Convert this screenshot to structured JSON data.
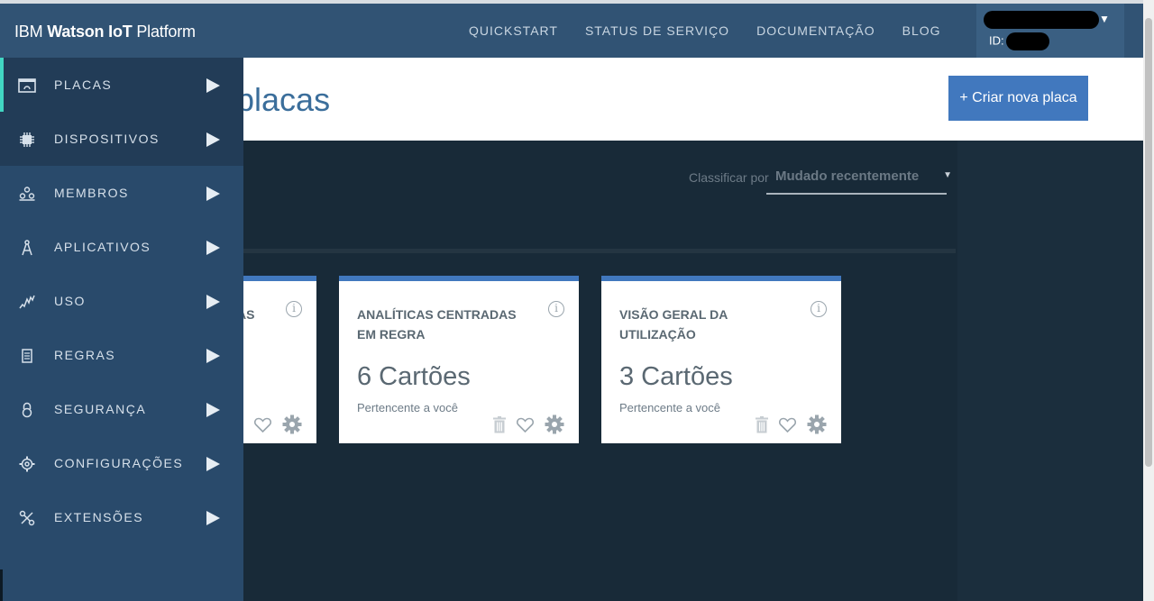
{
  "header": {
    "brand_prefix": "IBM",
    "brand_bold": "Watson IoT",
    "brand_suffix": "Platform",
    "nav": [
      "QUICKSTART",
      "STATUS DE SERVIÇO",
      "DOCUMENTAÇÃO",
      "BLOG"
    ],
    "account_caret": "▼",
    "account_id_label": "ID:"
  },
  "page": {
    "title": "placas",
    "create_button": "+ Criar nova placa"
  },
  "sort": {
    "label": "Classificar por",
    "value": "Mudado recentemente"
  },
  "cards": [
    {
      "title": "AS",
      "count": "",
      "owner": ""
    },
    {
      "title": "ANALÍTICAS CENTRADAS EM REGRA",
      "count": "6 Cartões",
      "owner": "Pertencente a você"
    },
    {
      "title": "VISÃO GERAL DA UTILIZAÇÃO",
      "count": "3 Cartões",
      "owner": "Pertencente a você"
    }
  ],
  "menu": [
    {
      "label": "PLACAS",
      "icon": "board-icon"
    },
    {
      "label": "DISPOSITIVOS",
      "icon": "chip-icon"
    },
    {
      "label": "MEMBROS",
      "icon": "members-icon"
    },
    {
      "label": "APLICATIVOS",
      "icon": "compass-icon"
    },
    {
      "label": "USO",
      "icon": "usage-chart-icon"
    },
    {
      "label": "REGRAS",
      "icon": "rules-document-icon"
    },
    {
      "label": "SEGURANÇA",
      "icon": "lock-icon"
    },
    {
      "label": "CONFIGURAÇÕES",
      "icon": "gear-icon"
    },
    {
      "label": "EXTENSÕES",
      "icon": "extensions-icon"
    }
  ],
  "colors": {
    "header_bg": "#315374",
    "menu_bg": "#294a6b",
    "accent_teal": "#41d6c3",
    "primary_blue": "#4178be",
    "content_bg": "#182a38"
  }
}
